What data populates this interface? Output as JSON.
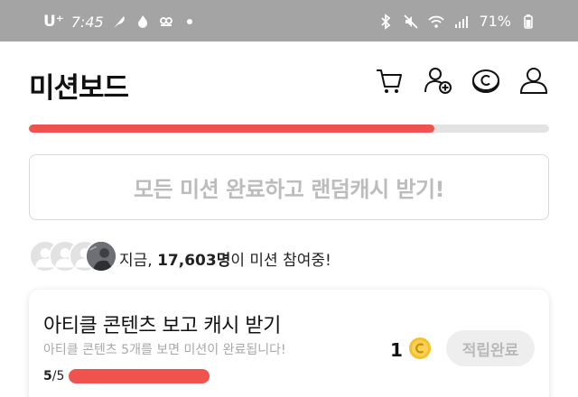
{
  "status_bar": {
    "carrier": "U⁺",
    "time": "7:45",
    "battery": "71%"
  },
  "header": {
    "title": "미션보드",
    "icons": [
      "cart-icon",
      "add-friend-icon",
      "cash-coin-icon",
      "profile-icon"
    ]
  },
  "progress": {
    "fraction": 0.78,
    "color": "#f0534d"
  },
  "all_missions": {
    "label": "모든 미션 완료하고 랜덤캐시 받기!"
  },
  "participants": {
    "prefix": "지금, ",
    "count": "17,603명",
    "suffix": "이 미션 참여중!"
  },
  "mission": {
    "title": "아티클 콘텐츠 보고 캐시 받기",
    "description": "아티클 콘텐츠 5개를 보면 미션이 완료됩니다!",
    "reward": "1",
    "claim_label": "적립완료",
    "done": "5",
    "total": "/5"
  }
}
